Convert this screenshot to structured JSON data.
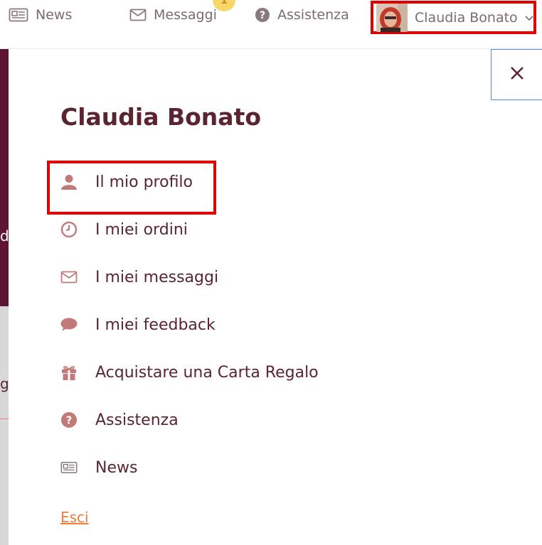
{
  "topnav": {
    "news": {
      "label": "News",
      "icon": "newspaper-icon"
    },
    "messages": {
      "label": "Messaggi",
      "icon": "envelope-icon",
      "badge": "1"
    },
    "help": {
      "label": "Assistenza",
      "icon": "question-circle-icon"
    },
    "user": {
      "name": "Claudia Bonato",
      "icon": "chevron-down-icon"
    }
  },
  "backdrop": {
    "char1": "d'",
    "char2": "g"
  },
  "panel": {
    "title": "Claudia Bonato",
    "close_icon": "close-icon",
    "menu": [
      {
        "label": "Il mio profilo",
        "icon": "user-icon"
      },
      {
        "label": "I miei ordini",
        "icon": "clock-icon"
      },
      {
        "label": "I miei messaggi",
        "icon": "envelope-icon"
      },
      {
        "label": "I miei feedback",
        "icon": "chat-bubble-icon"
      },
      {
        "label": "Acquistare una Carta Regalo",
        "icon": "gift-icon"
      },
      {
        "label": "Assistenza",
        "icon": "question-circle-icon"
      },
      {
        "label": "News",
        "icon": "newspaper-icon"
      }
    ],
    "logout": "Esci"
  },
  "colors": {
    "accent": "#5b2530",
    "icon": "#c27a78",
    "highlight": "#e00000",
    "link": "#f07d3a",
    "purple": "#5e1433"
  }
}
